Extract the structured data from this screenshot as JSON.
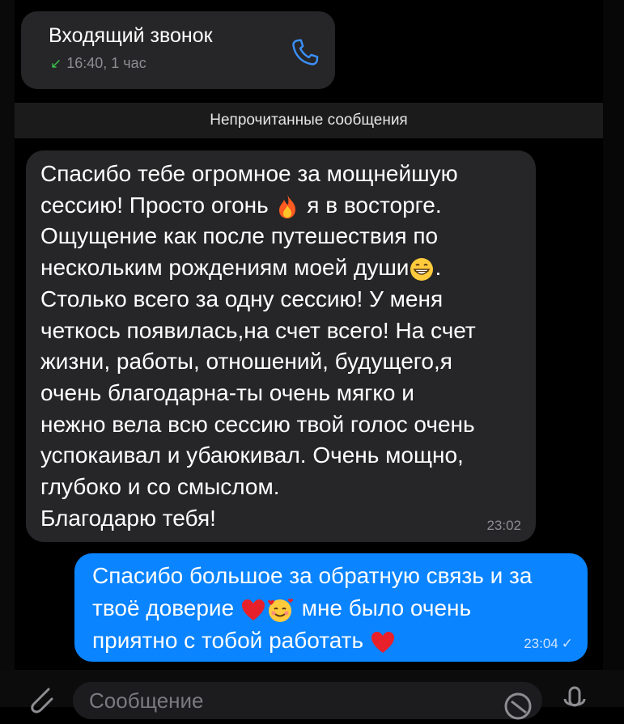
{
  "call": {
    "title": "Входящий звонок",
    "arrow": "↙",
    "meta": "16:40, 1 час",
    "icon": "phone-icon"
  },
  "unread_divider": "Непрочитанные сообщения",
  "incoming": {
    "seg1": "Спасибо тебе огромное за мощнейшую\nсессию! Просто огонь ",
    "seg2": " я в восторге.\nОщущение как после путешествия по\nнескольким рождениям моей души",
    "seg3": ".\nСтолько всего за одну сессию! У меня\nчеткось появилась,на счет всего! На счет\nжизни, работы, отношений, будущего,я\nочень благодарна-ты очень мягко и\nнежно вела всю сессию твой голос очень\nуспокаивал и убаюкивал. Очень мощно,\nглубоко и со смыслом.\nБлагодарю тебя!",
    "time": "23:02"
  },
  "outgoing": {
    "seg1": "Спасибо большое за обратную связь и за\nтвоё доверие ",
    "seg2": " мне было очень\nприятно с тобой работать ",
    "time": "23:04",
    "check": "✓"
  },
  "composer": {
    "placeholder": "Сообщение"
  },
  "colors": {
    "outgoing_bubble": "#0a84ff",
    "incoming_bubble": "#262628",
    "accent_icon": "#3b8ff6",
    "call_arrow": "#39c24a"
  }
}
